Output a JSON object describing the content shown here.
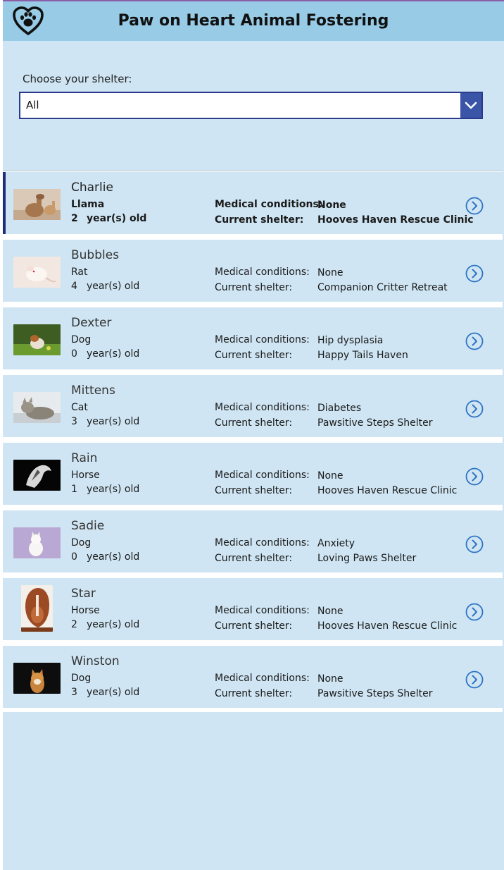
{
  "header": {
    "title": "Paw on Heart Animal Fostering",
    "logo": "paw-heart-icon"
  },
  "filter": {
    "label": "Choose your shelter:",
    "value": "All",
    "button_icon": "chevron-down-icon"
  },
  "labels": {
    "medical": "Medical conditions:",
    "shelter": "Current shelter:",
    "age_suffix": "year(s) old",
    "nav_icon": "chevron-right-circle-icon"
  },
  "pets": [
    {
      "name": "Charlie",
      "species": "Llama",
      "age": "2",
      "medical": "None",
      "shelter": "Hooves Haven Rescue Clinic",
      "photo": "llama-photo",
      "selected": true
    },
    {
      "name": "Bubbles",
      "species": "Rat",
      "age": "4",
      "medical": "None",
      "shelter": "Companion Critter Retreat",
      "photo": "rat-photo"
    },
    {
      "name": "Dexter",
      "species": "Dog",
      "age": "0",
      "medical": "Hip dysplasia",
      "shelter": "Happy Tails Haven",
      "photo": "dog-grass-photo"
    },
    {
      "name": "Mittens",
      "species": "Cat",
      "age": "3",
      "medical": "Diabetes",
      "shelter": "Pawsitive Steps Shelter",
      "photo": "cat-photo"
    },
    {
      "name": "Rain",
      "species": "Horse",
      "age": "1",
      "medical": "None",
      "shelter": "Hooves Haven Rescue Clinic",
      "photo": "horse-bw-photo"
    },
    {
      "name": "Sadie",
      "species": "Dog",
      "age": "0",
      "medical": "Anxiety",
      "shelter": "Loving Paws Shelter",
      "photo": "white-dog-photo"
    },
    {
      "name": "Star",
      "species": "Horse",
      "age": "2",
      "medical": "None",
      "shelter": "Hooves Haven Rescue Clinic",
      "photo": "pony-photo"
    },
    {
      "name": "Winston",
      "species": "Dog",
      "age": "3",
      "medical": "None",
      "shelter": "Pawsitive Steps Shelter",
      "photo": "shiba-photo"
    }
  ],
  "colors": {
    "header": "#97cbe6",
    "background": "#cfe5f3",
    "accent": "#2b3a8c",
    "dropdown_button": "#3a54a8",
    "nav_icon": "#2e74c4"
  }
}
